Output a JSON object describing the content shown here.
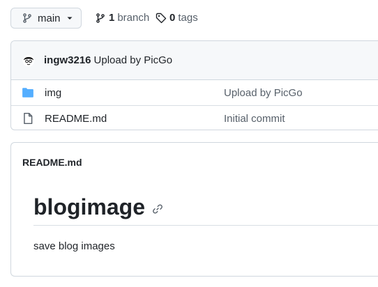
{
  "branch_selector": {
    "label": "main",
    "icon": "git-branch-icon"
  },
  "branches": {
    "count": "1",
    "label": "branch",
    "icon": "git-branch-icon"
  },
  "tags": {
    "count": "0",
    "label": "tags",
    "icon": "tag-icon"
  },
  "latest_commit": {
    "author": "ingw3216",
    "message": "Upload by PicGo",
    "avatar": "avatar"
  },
  "files": [
    {
      "name": "img",
      "type": "directory",
      "icon": "folder-icon",
      "commit_message": "Upload by PicGo"
    },
    {
      "name": "README.md",
      "type": "file",
      "icon": "file-icon",
      "commit_message": "Initial commit"
    }
  ],
  "readme": {
    "file_title": "README.md",
    "heading": "blogimage",
    "body": "save blog images"
  },
  "colors": {
    "folder": "#54aeff",
    "border": "#d0d7de",
    "muted_text": "#57606a",
    "text": "#1f2328"
  }
}
